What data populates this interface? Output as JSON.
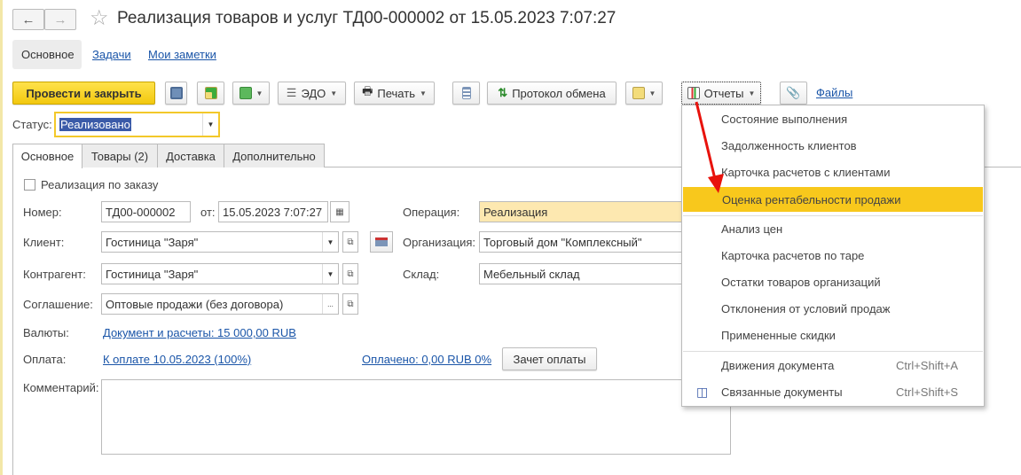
{
  "window": {
    "title": "Реализация товаров и услуг ТД00-000002 от 15.05.2023 7:07:27"
  },
  "page_tabs": [
    {
      "label": "Основное"
    },
    {
      "label": "Задачи"
    },
    {
      "label": "Мои заметки"
    }
  ],
  "toolbar": {
    "post_close": "Провести и закрыть",
    "edo": "ЭДО",
    "print": "Печать",
    "exchange_log": "Протокол обмена",
    "reports": "Отчеты",
    "files": "Файлы"
  },
  "status": {
    "label": "Статус:",
    "value": "Реализовано"
  },
  "form_tabs": [
    {
      "label": "Основное"
    },
    {
      "label": "Товары (2)"
    },
    {
      "label": "Доставка"
    },
    {
      "label": "Дополнительно"
    }
  ],
  "form": {
    "by_order": "Реализация по заказу",
    "number_label": "Номер:",
    "number": "ТД00-000002",
    "from_label": "от:",
    "date": "15.05.2023  7:07:27",
    "operation_label": "Операция:",
    "operation": "Реализация",
    "client_label": "Клиент:",
    "client": "Гостиница \"Заря\"",
    "org_label": "Организация:",
    "org": "Торговый дом \"Комплексный\"",
    "contractor_label": "Контрагент:",
    "contractor": "Гостиница \"Заря\"",
    "warehouse_label": "Склад:",
    "warehouse": "Мебельный склад",
    "agreement_label": "Соглашение:",
    "agreement": "Оптовые продажи (без договора)",
    "currency_label": "Валюты:",
    "currency_link": "Документ и расчеты: 15 000,00 RUB",
    "payment_label": "Оплата:",
    "payment_link": "К оплате 10.05.2023 (100%)",
    "paid_link": "Оплачено: 0,00 RUB 0%",
    "offset_button": "Зачет оплаты",
    "comment_label": "Комментарий:"
  },
  "reports_menu": {
    "items": [
      {
        "label": "Состояние выполнения"
      },
      {
        "label": "Задолженность клиентов"
      },
      {
        "label": "Карточка расчетов с клиентами"
      },
      {
        "label": "Оценка рентабельности продажи",
        "highlighted": true
      },
      {
        "label": "Анализ цен"
      },
      {
        "label": "Карточка расчетов по таре"
      },
      {
        "label": "Остатки товаров организаций"
      },
      {
        "label": "Отклонения от условий продаж"
      },
      {
        "label": "Примененные скидки"
      },
      {
        "label": "Движения документа",
        "shortcut": "Ctrl+Shift+A"
      },
      {
        "label": "Связанные документы",
        "shortcut": "Ctrl+Shift+S"
      }
    ]
  },
  "colors": {
    "accent": "#f8c81c",
    "link": "#1a55a8",
    "arrow": "#e8120c"
  }
}
